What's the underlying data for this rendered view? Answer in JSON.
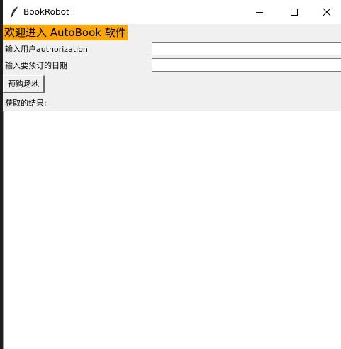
{
  "window": {
    "title": "BookRobot",
    "app_icon": "feather-icon",
    "controls": {
      "minimize_icon": "minimize-icon",
      "maximize_icon": "maximize-icon",
      "close_icon": "close-icon"
    }
  },
  "main": {
    "welcome_text": "欢迎进入 AutoBook 软件",
    "welcome_bg": "#ffa500",
    "authorization_label": "输入用户authorization",
    "authorization_value": "",
    "date_label": "输入要预订的日期",
    "date_value": "",
    "book_button_label": "预购场地",
    "result_label": "获取的结果:",
    "result_text": ""
  }
}
